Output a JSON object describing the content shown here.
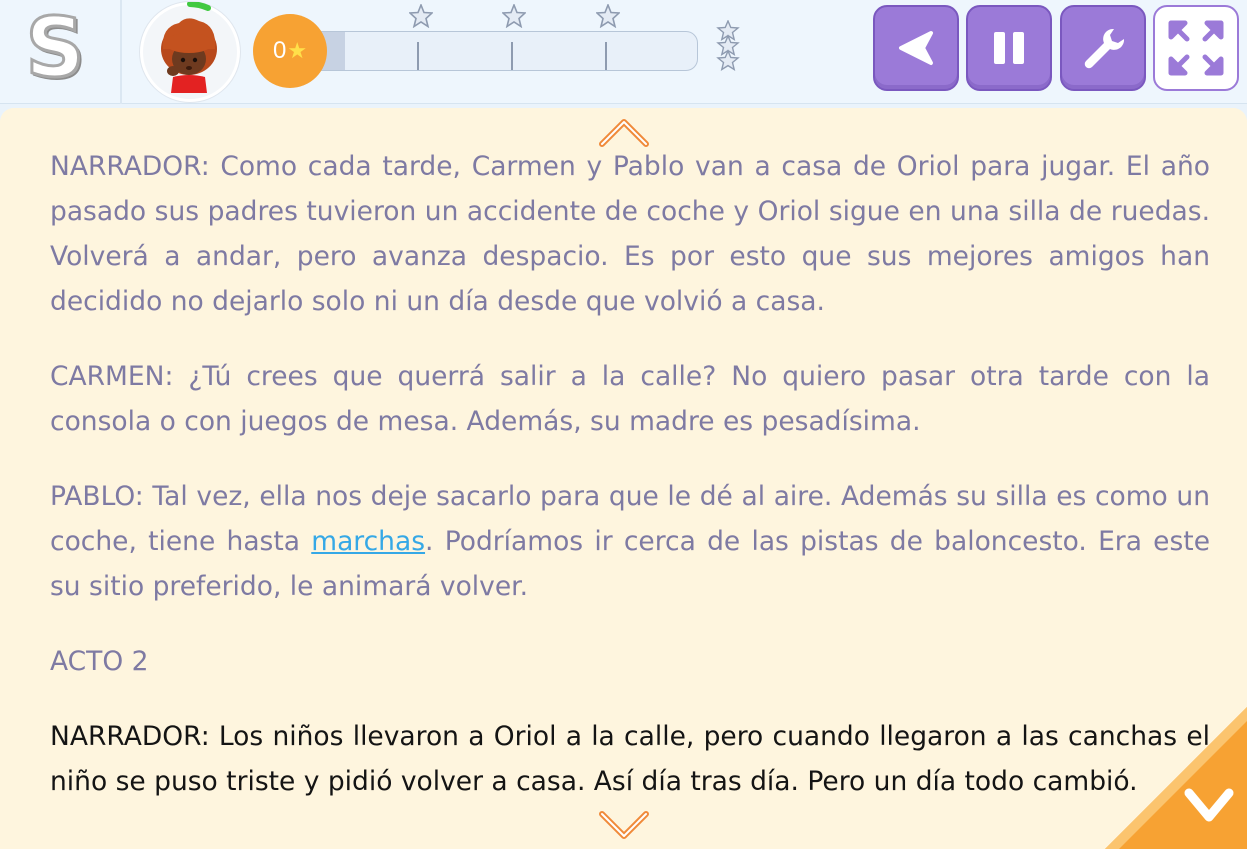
{
  "app": {
    "logo_letter": "S",
    "score": "0",
    "progress_fraction": 0.07,
    "level_stars": 3
  },
  "toolbar": {
    "back_icon": "back-arrow-icon",
    "pause_icon": "pause-icon",
    "tools_icon": "wrench-icon",
    "fullscreen_icon": "fullscreen-icon"
  },
  "reading": {
    "paragraphs": [
      {
        "text": "NARRADOR: Como cada tarde, Carmen y Pablo van a casa de Oriol para jugar. El año pasado sus padres tuvieron un accidente de coche y Oriol sigue en una silla de ruedas. Volverá a andar, pero avanza despacio. Es por esto que sus mejores amigos han decidido no dejarlo solo ni un día desde que volvió a casa."
      },
      {
        "text": "CARMEN: ¿Tú crees que querrá salir a la calle? No quiero pasar otra tarde con la consola o con juegos de mesa. Además, su madre es pesadísima."
      },
      {
        "before": "PABLO: Tal vez, ella nos deje sacarlo para que le dé al aire. Además su silla es como un coche, tiene hasta ",
        "link": "marchas",
        "after": ". Podríamos ir cerca de las pistas de baloncesto. Era este su sitio preferido, le animará volver."
      },
      {
        "text": "ACTO 2"
      },
      {
        "text": "NARRADOR: Los niños llevaron a Oriol a la calle, pero cuando llegaron a las canchas el niño se puso triste y pidió volver a casa. Así día tras día. Pero un día todo cambió."
      }
    ]
  },
  "colors": {
    "accent_purple": "#9b7ad8",
    "accent_orange": "#f7a233",
    "text_muted": "#7e7aa3",
    "text_active": "#141414",
    "link": "#35a8e6",
    "panel_bg": "#fef5de"
  }
}
